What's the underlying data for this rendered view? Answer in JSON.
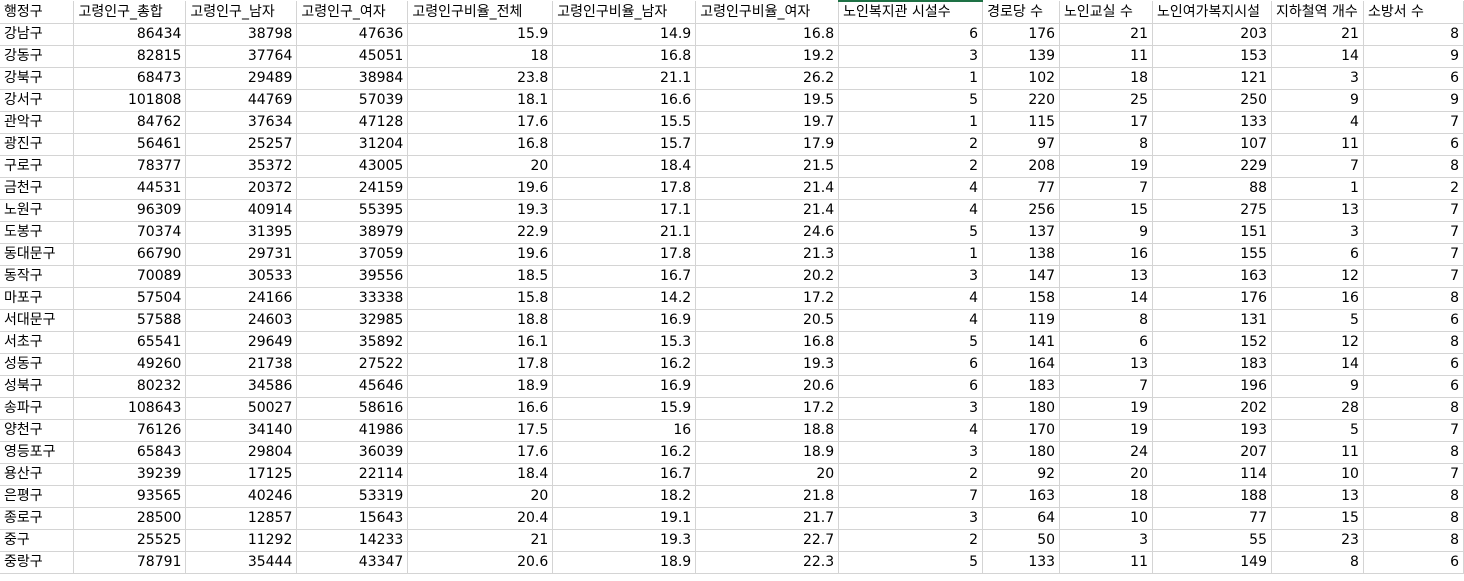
{
  "headers": [
    "행정구",
    "고령인구_총합",
    "고령인구_남자",
    "고령인구_여자",
    "고령인구비율_전체",
    "고령인구비율_남자",
    "고령인구비율_여자",
    "노인복지관 시설수",
    "경로당 수",
    "노인교실 수",
    "노인여가복지시설",
    "지하철역 개수",
    "소방서 수"
  ],
  "rows": [
    [
      "강남구",
      "86434",
      "38798",
      "47636",
      "15.9",
      "14.9",
      "16.8",
      "6",
      "176",
      "21",
      "203",
      "21",
      "8"
    ],
    [
      "강동구",
      "82815",
      "37764",
      "45051",
      "18",
      "16.8",
      "19.2",
      "3",
      "139",
      "11",
      "153",
      "14",
      "9"
    ],
    [
      "강북구",
      "68473",
      "29489",
      "38984",
      "23.8",
      "21.1",
      "26.2",
      "1",
      "102",
      "18",
      "121",
      "3",
      "6"
    ],
    [
      "강서구",
      "101808",
      "44769",
      "57039",
      "18.1",
      "16.6",
      "19.5",
      "5",
      "220",
      "25",
      "250",
      "9",
      "9"
    ],
    [
      "관악구",
      "84762",
      "37634",
      "47128",
      "17.6",
      "15.5",
      "19.7",
      "1",
      "115",
      "17",
      "133",
      "4",
      "7"
    ],
    [
      "광진구",
      "56461",
      "25257",
      "31204",
      "16.8",
      "15.7",
      "17.9",
      "2",
      "97",
      "8",
      "107",
      "11",
      "6"
    ],
    [
      "구로구",
      "78377",
      "35372",
      "43005",
      "20",
      "18.4",
      "21.5",
      "2",
      "208",
      "19",
      "229",
      "7",
      "8"
    ],
    [
      "금천구",
      "44531",
      "20372",
      "24159",
      "19.6",
      "17.8",
      "21.4",
      "4",
      "77",
      "7",
      "88",
      "1",
      "2"
    ],
    [
      "노원구",
      "96309",
      "40914",
      "55395",
      "19.3",
      "17.1",
      "21.4",
      "4",
      "256",
      "15",
      "275",
      "13",
      "7"
    ],
    [
      "도봉구",
      "70374",
      "31395",
      "38979",
      "22.9",
      "21.1",
      "24.6",
      "5",
      "137",
      "9",
      "151",
      "3",
      "7"
    ],
    [
      "동대문구",
      "66790",
      "29731",
      "37059",
      "19.6",
      "17.8",
      "21.3",
      "1",
      "138",
      "16",
      "155",
      "6",
      "7"
    ],
    [
      "동작구",
      "70089",
      "30533",
      "39556",
      "18.5",
      "16.7",
      "20.2",
      "3",
      "147",
      "13",
      "163",
      "12",
      "7"
    ],
    [
      "마포구",
      "57504",
      "24166",
      "33338",
      "15.8",
      "14.2",
      "17.2",
      "4",
      "158",
      "14",
      "176",
      "16",
      "8"
    ],
    [
      "서대문구",
      "57588",
      "24603",
      "32985",
      "18.8",
      "16.9",
      "20.5",
      "4",
      "119",
      "8",
      "131",
      "5",
      "6"
    ],
    [
      "서초구",
      "65541",
      "29649",
      "35892",
      "16.1",
      "15.3",
      "16.8",
      "5",
      "141",
      "6",
      "152",
      "12",
      "8"
    ],
    [
      "성동구",
      "49260",
      "21738",
      "27522",
      "17.8",
      "16.2",
      "19.3",
      "6",
      "164",
      "13",
      "183",
      "14",
      "6"
    ],
    [
      "성북구",
      "80232",
      "34586",
      "45646",
      "18.9",
      "16.9",
      "20.6",
      "6",
      "183",
      "7",
      "196",
      "9",
      "6"
    ],
    [
      "송파구",
      "108643",
      "50027",
      "58616",
      "16.6",
      "15.9",
      "17.2",
      "3",
      "180",
      "19",
      "202",
      "28",
      "8"
    ],
    [
      "양천구",
      "76126",
      "34140",
      "41986",
      "17.5",
      "16",
      "18.8",
      "4",
      "170",
      "19",
      "193",
      "5",
      "7"
    ],
    [
      "영등포구",
      "65843",
      "29804",
      "36039",
      "17.6",
      "16.2",
      "18.9",
      "3",
      "180",
      "24",
      "207",
      "11",
      "8"
    ],
    [
      "용산구",
      "39239",
      "17125",
      "22114",
      "18.4",
      "16.7",
      "20",
      "2",
      "92",
      "20",
      "114",
      "10",
      "7"
    ],
    [
      "은평구",
      "93565",
      "40246",
      "53319",
      "20",
      "18.2",
      "21.8",
      "7",
      "163",
      "18",
      "188",
      "13",
      "8"
    ],
    [
      "종로구",
      "28500",
      "12857",
      "15643",
      "20.4",
      "19.1",
      "21.7",
      "3",
      "64",
      "10",
      "77",
      "15",
      "8"
    ],
    [
      "중구",
      "25525",
      "11292",
      "14233",
      "21",
      "19.3",
      "22.7",
      "2",
      "50",
      "3",
      "55",
      "23",
      "8"
    ],
    [
      "중랑구",
      "78791",
      "35444",
      "43347",
      "20.6",
      "18.9",
      "22.3",
      "5",
      "133",
      "11",
      "149",
      "8",
      "6"
    ]
  ]
}
